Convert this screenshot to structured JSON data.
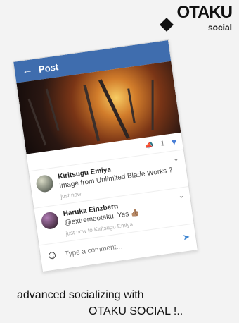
{
  "brand": {
    "name": "OTAKU",
    "sub": "social"
  },
  "header": {
    "title": "Post",
    "back_icon": "arrow-left-icon"
  },
  "post": {
    "likes": "1",
    "megaphone_icon": "megaphone-icon",
    "heart_icon": "heart-icon"
  },
  "comments": [
    {
      "name": "Kiritsugu Emiya",
      "text": "Image from Unlimited Blade Works ?",
      "time": "just now"
    },
    {
      "name": "Haruka Einzbern",
      "text": "@extremeotaku, Yes 👍🏽",
      "time": "just now to Kiritsugu Emiya"
    }
  ],
  "composer": {
    "placeholder": "Type a comment...",
    "emoji_icon": "emoji-icon",
    "send_icon": "send-icon"
  },
  "captions": {
    "line1": "advanced socializing with",
    "line2": "OTAKU SOCIAL !.."
  },
  "colors": {
    "header_bg": "#3f6dae",
    "heart": "#4a7fd6",
    "send": "#3f86d2",
    "page_bg": "#f3f3f3"
  }
}
